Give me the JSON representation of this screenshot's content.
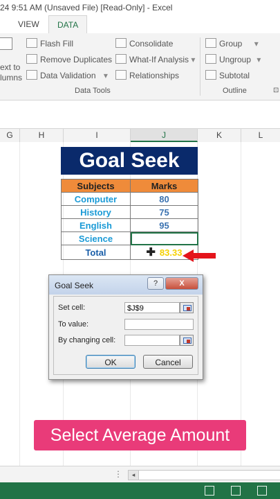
{
  "title": "24 9:51 AM (Unsaved File)  [Read-Only] - Excel",
  "tabs": {
    "view": "VIEW",
    "data": "DATA"
  },
  "ribbon": {
    "text_to_columns_1": "ext to",
    "text_to_columns_2": "lumns",
    "flash_fill": "Flash Fill",
    "remove_duplicates": "Remove Duplicates",
    "data_validation": "Data Validation",
    "consolidate": "Consolidate",
    "what_if": "What-If Analysis",
    "relationships": "Relationships",
    "group": "Group",
    "ungroup": "Ungroup",
    "subtotal": "Subtotal",
    "data_tools_label": "Data Tools",
    "outline_label": "Outline"
  },
  "columns": [
    "G",
    "H",
    "I",
    "J",
    "K",
    "L"
  ],
  "banner": "Goal Seek",
  "table": {
    "headers": [
      "Subjects",
      "Marks"
    ],
    "rows": [
      {
        "subject": "Computer",
        "marks": "80"
      },
      {
        "subject": "History",
        "marks": "75"
      },
      {
        "subject": "English",
        "marks": "95"
      },
      {
        "subject": "Science",
        "marks": ""
      }
    ],
    "total_label": "Total",
    "total_value": "83.33"
  },
  "dialog": {
    "title": "Goal Seek",
    "help": "?",
    "close": "X",
    "set_cell_label": "Set cell:",
    "set_cell_value": "$J$9",
    "to_value_label": "To value:",
    "to_value_value": "",
    "changing_cell_label": "By changing cell:",
    "changing_cell_value": "",
    "ok": "OK",
    "cancel": "Cancel"
  },
  "caption": "Select Average Amount",
  "colors": {
    "excel_green": "#217346",
    "banner": "#0a2a6b",
    "header_orange": "#ef8b3a",
    "caption_pink": "#e93b79"
  }
}
